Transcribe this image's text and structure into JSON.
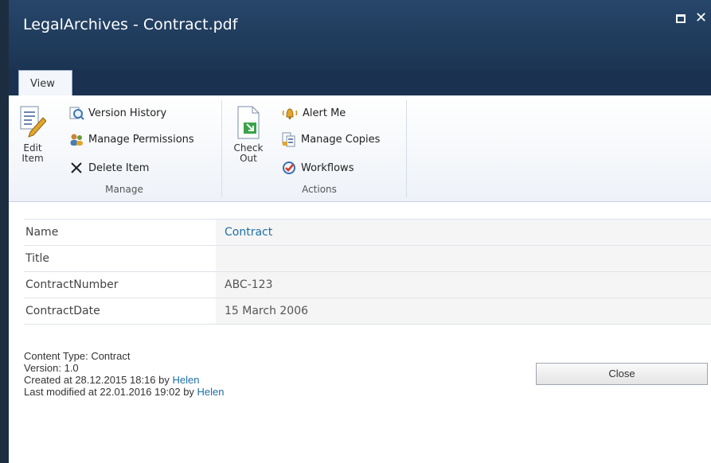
{
  "window": {
    "title": "LegalArchives - Contract.pdf"
  },
  "ribbon": {
    "tabs": [
      "View"
    ],
    "manage": {
      "label": "Manage",
      "edit_item": [
        "Edit",
        "Item"
      ],
      "version_history": "Version History",
      "manage_permissions": "Manage Permissions",
      "delete_item": "Delete Item"
    },
    "actions": {
      "label": "Actions",
      "check_out": [
        "Check",
        "Out"
      ],
      "alert_me": "Alert Me",
      "manage_copies": "Manage Copies",
      "workflows": "Workflows"
    }
  },
  "properties": [
    {
      "label": "Name",
      "value": "Contract"
    },
    {
      "label": "Title",
      "value": ""
    },
    {
      "label": "ContractNumber",
      "value": "ABC-123"
    },
    {
      "label": "ContractDate",
      "value": "15 March 2006"
    }
  ],
  "meta": {
    "content_type": "Content Type: Contract",
    "version": "Version: 1.0",
    "created_prefix": "Created at 28.12.2015 18:16 by ",
    "created_by": "Helen",
    "modified_prefix": "Last modified at 22.01.2016 19:02 by ",
    "modified_by": "Helen"
  },
  "buttons": {
    "close": "Close"
  },
  "colors": {
    "titlebar": "#1c3452",
    "link": "#1d6fa8"
  },
  "icons": [
    "maximize-icon",
    "close-icon",
    "edit-item-icon",
    "version-history-icon",
    "manage-permissions-icon",
    "delete-icon",
    "check-out-icon",
    "alert-icon",
    "manage-copies-icon",
    "workflows-icon"
  ]
}
